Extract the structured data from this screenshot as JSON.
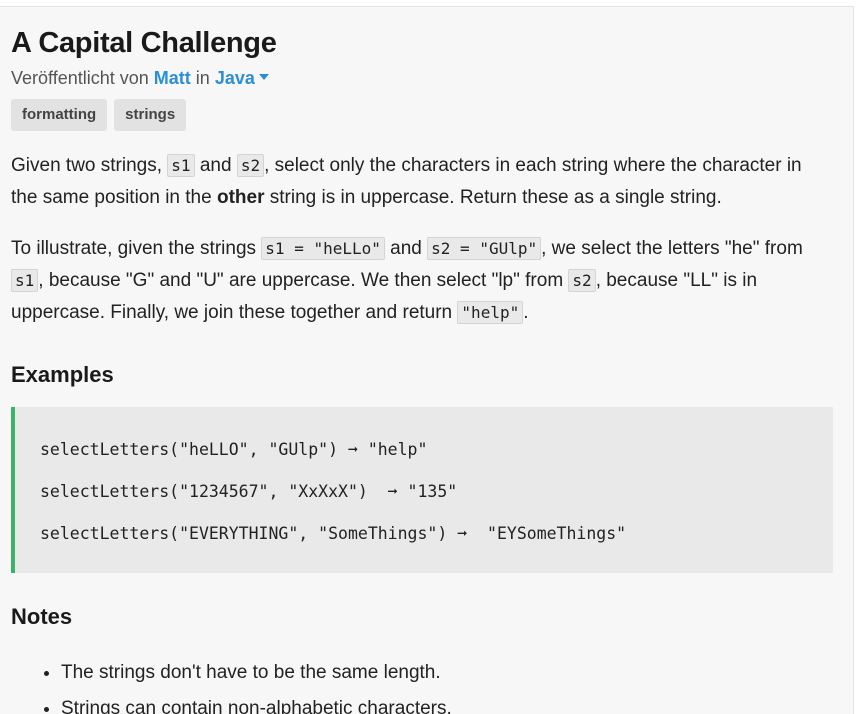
{
  "challenge": {
    "title": "A Capital Challenge",
    "published_prefix": "Veröffentlicht von",
    "author": "Matt",
    "in_word": "in",
    "language": "Java"
  },
  "tags": [
    "formatting",
    "strings"
  ],
  "description": {
    "p1": {
      "t1": "Given two strings, ",
      "c1": "s1",
      "t2": " and ",
      "c2": "s2",
      "t3": ", select only the characters in each string where the character in the same position in the ",
      "bold": "other",
      "t4": " string is in uppercase. Return these as a single string."
    },
    "p2": {
      "t1": "To illustrate, given the strings ",
      "c1": "s1 = \"heLLo\"",
      "t2": " and ",
      "c2": "s2 = \"GUlp\"",
      "t3": ", we select the letters \"he\" from ",
      "c3": "s1",
      "t4": ", because \"G\" and \"U\" are uppercase. We then select \"lp\" from ",
      "c4": "s2",
      "t5": ", because \"LL\" is in uppercase. Finally, we join these together and return ",
      "c5": "\"help\"",
      "t6": "."
    }
  },
  "examples_heading": "Examples",
  "examples": [
    "selectLetters(\"heLLO\", \"GUlp\") ➞ \"help\"",
    "selectLetters(\"1234567\", \"XxXxX\")  ➞ \"135\"",
    "selectLetters(\"EVERYTHING\", \"SomeThings\") ➞  \"EYSomeThings\""
  ],
  "notes_heading": "Notes",
  "notes": [
    "The strings don't have to be the same length.",
    "Strings can contain non-alphabetic characters."
  ],
  "colors": {
    "link": "#2b8fd6",
    "example_border": "#3bb36b",
    "page_bg": "#f7f7f7"
  }
}
